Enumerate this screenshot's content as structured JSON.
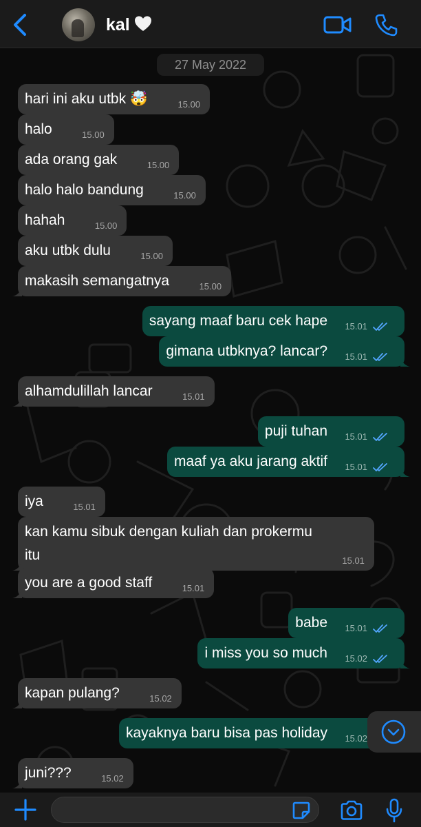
{
  "header": {
    "contact_name": "kal"
  },
  "chat": {
    "date": "27 May 2022",
    "messages": [
      {
        "dir": "in",
        "text": "hari ini aku utbk 🤯",
        "time": "15.00"
      },
      {
        "dir": "in",
        "text": "halo",
        "time": "15.00"
      },
      {
        "dir": "in",
        "text": "ada orang gak",
        "time": "15.00"
      },
      {
        "dir": "in",
        "text": "halo halo bandung",
        "time": "15.00"
      },
      {
        "dir": "in",
        "text": "hahah",
        "time": "15.00"
      },
      {
        "dir": "in",
        "text": "aku utbk dulu",
        "time": "15.00"
      },
      {
        "dir": "in",
        "text": "makasih semangatnya",
        "time": "15.00"
      },
      {
        "dir": "out",
        "text": "sayang maaf baru cek hape",
        "time": "15.01",
        "status": "read"
      },
      {
        "dir": "out",
        "text": "gimana utbknya? lancar?",
        "time": "15.01",
        "status": "read"
      },
      {
        "dir": "in",
        "text": "alhamdulillah lancar",
        "time": "15.01"
      },
      {
        "dir": "out",
        "text": "puji tuhan",
        "time": "15.01",
        "status": "read"
      },
      {
        "dir": "out",
        "text": "maaf ya aku jarang aktif",
        "time": "15.01",
        "status": "read"
      },
      {
        "dir": "in",
        "text": "iya",
        "time": "15.01"
      },
      {
        "dir": "in",
        "text": "kan kamu sibuk dengan kuliah dan prokermu",
        "text2": "itu",
        "time": "15.01"
      },
      {
        "dir": "in",
        "text": "you are a good staff",
        "time": "15.01"
      },
      {
        "dir": "out",
        "text": "babe",
        "time": "15.01",
        "status": "read"
      },
      {
        "dir": "out",
        "text": "i miss you so much",
        "time": "15.02",
        "status": "read"
      },
      {
        "dir": "in",
        "text": "kapan pulang?",
        "time": "15.02"
      },
      {
        "dir": "out",
        "text": "kayaknya baru bisa pas holiday",
        "time": "15.02",
        "status": "read"
      },
      {
        "dir": "in",
        "text": "juni???",
        "time": "15.02"
      }
    ]
  },
  "input": {
    "placeholder": ""
  },
  "colors": {
    "accent": "#1f8bff",
    "incoming_bubble": "#363636",
    "outgoing_bubble": "#0b4a3f",
    "read_ticks": "#53a6ff"
  },
  "icons": [
    "back-chevron-icon",
    "white-heart-icon",
    "video-call-icon",
    "phone-call-icon",
    "double-check-icon",
    "scroll-down-icon",
    "plus-icon",
    "sticker-icon",
    "camera-icon",
    "microphone-icon"
  ]
}
